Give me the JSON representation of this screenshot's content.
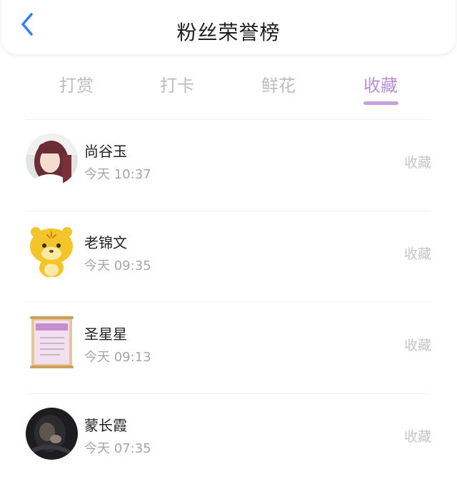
{
  "header": {
    "back_icon": "chevron-left-icon",
    "title": "粉丝荣誉榜"
  },
  "colors": {
    "accent": "#b98ed6",
    "back_icon": "#2f80ff",
    "inactive_tab": "#bdbdbd",
    "secondary_text": "#a6a6a6"
  },
  "tabs": [
    {
      "label": "打赏",
      "active": false
    },
    {
      "label": "打卡",
      "active": false
    },
    {
      "label": "鲜花",
      "active": false
    },
    {
      "label": "收藏",
      "active": true
    }
  ],
  "fans": [
    {
      "name": "尚谷玉",
      "time": "今天 10:37",
      "action": "收藏",
      "avatar": "girl-photo-avatar"
    },
    {
      "name": "老锦文",
      "time": "今天 09:35",
      "action": "收藏",
      "avatar": "tiger-cartoon-avatar"
    },
    {
      "name": "圣星星",
      "time": "今天 09:13",
      "action": "收藏",
      "avatar": "pink-scroll-avatar"
    },
    {
      "name": "蒙长霞",
      "time": "今天 07:35",
      "action": "收藏",
      "avatar": "dark-photo-avatar"
    }
  ]
}
